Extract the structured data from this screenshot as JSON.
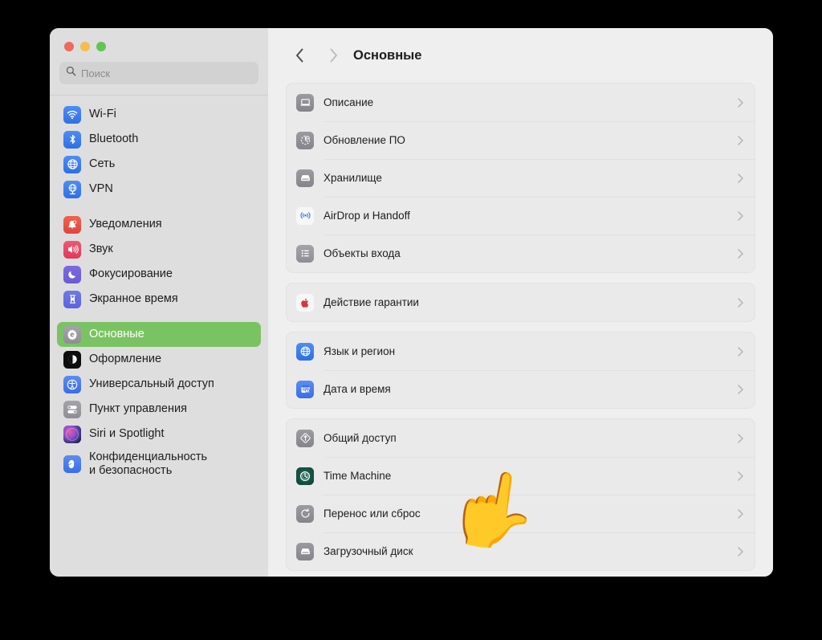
{
  "window": {
    "title": "Основные",
    "traffic_lights": [
      "close",
      "minimize",
      "maximize"
    ],
    "colors": {
      "accent_selected": "#7ac362",
      "sidebar_bg": "#dedede",
      "content_bg": "#efefef",
      "card_bg": "#eaeaea",
      "close": "#ed6a5e",
      "minimize": "#f5bd4f",
      "maximize": "#61c454"
    }
  },
  "search": {
    "placeholder": "Поиск",
    "value": "",
    "icon": "search-icon"
  },
  "sidebar": {
    "groups": [
      {
        "items": [
          {
            "label": "Wi-Fi",
            "icon": "wifi-icon",
            "selected": false
          },
          {
            "label": "Bluetooth",
            "icon": "bluetooth-icon",
            "selected": false
          },
          {
            "label": "Сеть",
            "icon": "network-globe-icon",
            "selected": false
          },
          {
            "label": "VPN",
            "icon": "vpn-icon",
            "selected": false
          }
        ]
      },
      {
        "items": [
          {
            "label": "Уведомления",
            "icon": "bell-icon",
            "selected": false
          },
          {
            "label": "Звук",
            "icon": "speaker-icon",
            "selected": false
          },
          {
            "label": "Фокусирование",
            "icon": "moon-icon",
            "selected": false
          },
          {
            "label": "Экранное время",
            "icon": "hourglass-icon",
            "selected": false
          }
        ]
      },
      {
        "items": [
          {
            "label": "Основные",
            "icon": "gear-icon",
            "selected": true
          },
          {
            "label": "Оформление",
            "icon": "appearance-icon",
            "selected": false
          },
          {
            "label": "Универсальный доступ",
            "icon": "accessibility-icon",
            "selected": false
          },
          {
            "label": "Пункт управления",
            "icon": "control-center-icon",
            "selected": false
          },
          {
            "label": "Siri и Spotlight",
            "icon": "siri-icon",
            "selected": false
          },
          {
            "label": "Конфиденциальность и безопасность",
            "label_line1": "Конфиденциальность",
            "label_line2": "и безопасность",
            "icon": "privacy-hand-icon",
            "selected": false
          }
        ]
      }
    ]
  },
  "toolbar": {
    "back_icon": "chevron-left-icon",
    "forward_icon": "chevron-right-icon",
    "title": "Основные"
  },
  "main": {
    "groups": [
      {
        "rows": [
          {
            "label": "Описание",
            "icon": "laptop-icon",
            "icon_bg": "bg-gray"
          },
          {
            "label": "Обновление ПО",
            "icon": "software-update-icon",
            "icon_bg": "bg-gray"
          },
          {
            "label": "Хранилище",
            "icon": "storage-drive-icon",
            "icon_bg": "bg-gray"
          },
          {
            "label": "AirDrop и Handoff",
            "icon": "airdrop-icon",
            "icon_bg": "bg-white"
          },
          {
            "label": "Объекты входа",
            "icon": "login-items-list-icon",
            "icon_bg": "bg-gray2"
          }
        ]
      },
      {
        "rows": [
          {
            "label": "Действие гарантии",
            "icon": "apple-care-icon",
            "icon_bg": "bg-white"
          }
        ]
      },
      {
        "rows": [
          {
            "label": "Язык и регион",
            "icon": "language-globe-icon",
            "icon_bg": "bg-blue"
          },
          {
            "label": "Дата и время",
            "icon": "date-time-calendar-icon",
            "icon_bg": "bg-blue2"
          }
        ]
      },
      {
        "rows": [
          {
            "label": "Общий доступ",
            "icon": "sharing-icon",
            "icon_bg": "bg-gray"
          },
          {
            "label": "Time Machine",
            "icon": "time-machine-icon",
            "icon_bg": "bg-green"
          },
          {
            "label": "Перенос или сброс",
            "icon": "transfer-reset-icon",
            "icon_bg": "bg-gray"
          },
          {
            "label": "Загрузочный диск",
            "icon": "startup-disk-icon",
            "icon_bg": "bg-gray"
          }
        ]
      }
    ],
    "row_chevron_icon": "chevron-right-icon"
  },
  "overlay": {
    "cursor_emoji": "👆",
    "cursor_name": "pointing-hand-emoji"
  }
}
